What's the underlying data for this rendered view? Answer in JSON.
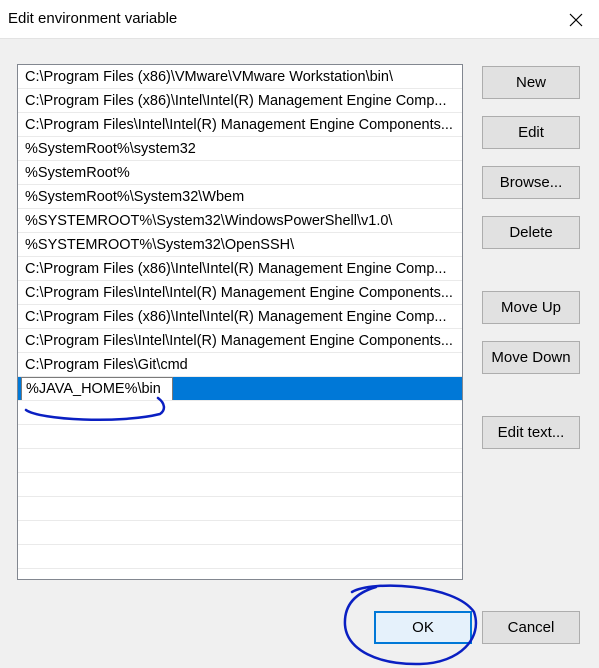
{
  "window": {
    "title": "Edit environment variable"
  },
  "icons": {
    "close": "close-icon"
  },
  "list": {
    "items": [
      "C:\\Program Files (x86)\\VMware\\VMware Workstation\\bin\\",
      "C:\\Program Files (x86)\\Intel\\Intel(R) Management Engine Comp...",
      "C:\\Program Files\\Intel\\Intel(R) Management Engine Components...",
      "%SystemRoot%\\system32",
      "%SystemRoot%",
      "%SystemRoot%\\System32\\Wbem",
      "%SYSTEMROOT%\\System32\\WindowsPowerShell\\v1.0\\",
      "%SYSTEMROOT%\\System32\\OpenSSH\\",
      "C:\\Program Files (x86)\\Intel\\Intel(R) Management Engine Comp...",
      "C:\\Program Files\\Intel\\Intel(R) Management Engine Components...",
      "C:\\Program Files (x86)\\Intel\\Intel(R) Management Engine Comp...",
      "C:\\Program Files\\Intel\\Intel(R) Management Engine Components...",
      "C:\\Program Files\\Git\\cmd"
    ],
    "editing_value": "%JAVA_HOME%\\bin"
  },
  "buttons": {
    "new": "New",
    "edit": "Edit",
    "browse": "Browse...",
    "delete": "Delete",
    "move_up": "Move Up",
    "move_down": "Move Down",
    "edit_text": "Edit text...",
    "ok": "OK",
    "cancel": "Cancel"
  },
  "colors": {
    "selection": "#0078d7",
    "annotation": "#0a1fc2"
  }
}
